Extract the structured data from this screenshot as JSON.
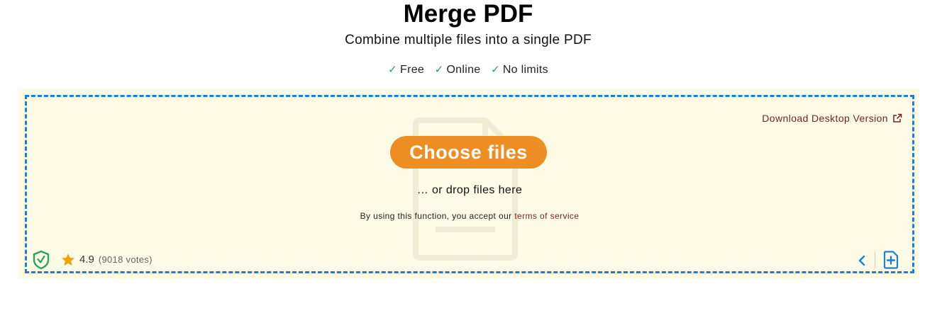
{
  "header": {
    "title": "Merge PDF",
    "subtitle": "Combine multiple files into a single PDF",
    "features": [
      {
        "check": "✓",
        "label": "Free"
      },
      {
        "check": "✓",
        "label": "Online"
      },
      {
        "check": "✓",
        "label": "No limits"
      }
    ]
  },
  "dropzone": {
    "desktop_link": "Download Desktop Version",
    "desktop_link_icon": "external-link-icon",
    "choose_button": "Choose files",
    "drop_hint": "… or drop files here",
    "terms_prefix": "By using this function, you accept our",
    "terms_link": "terms of service",
    "watermark_icon": "document-icon"
  },
  "footer": {
    "security_icon": "shield-check-icon",
    "rating_icon": "star-icon",
    "rating": "4.9",
    "votes": "(9018 votes)",
    "prev_icon": "chevron-left-icon",
    "add_icon": "add-file-icon"
  },
  "colors": {
    "accent_button": "#ee8e22",
    "dropzone_border": "#1b7fd6",
    "dropzone_background": "#fdfbe6",
    "link": "#7a1f1f",
    "check": "#27a35a",
    "shield": "#27a35a",
    "star": "#f0a000"
  }
}
